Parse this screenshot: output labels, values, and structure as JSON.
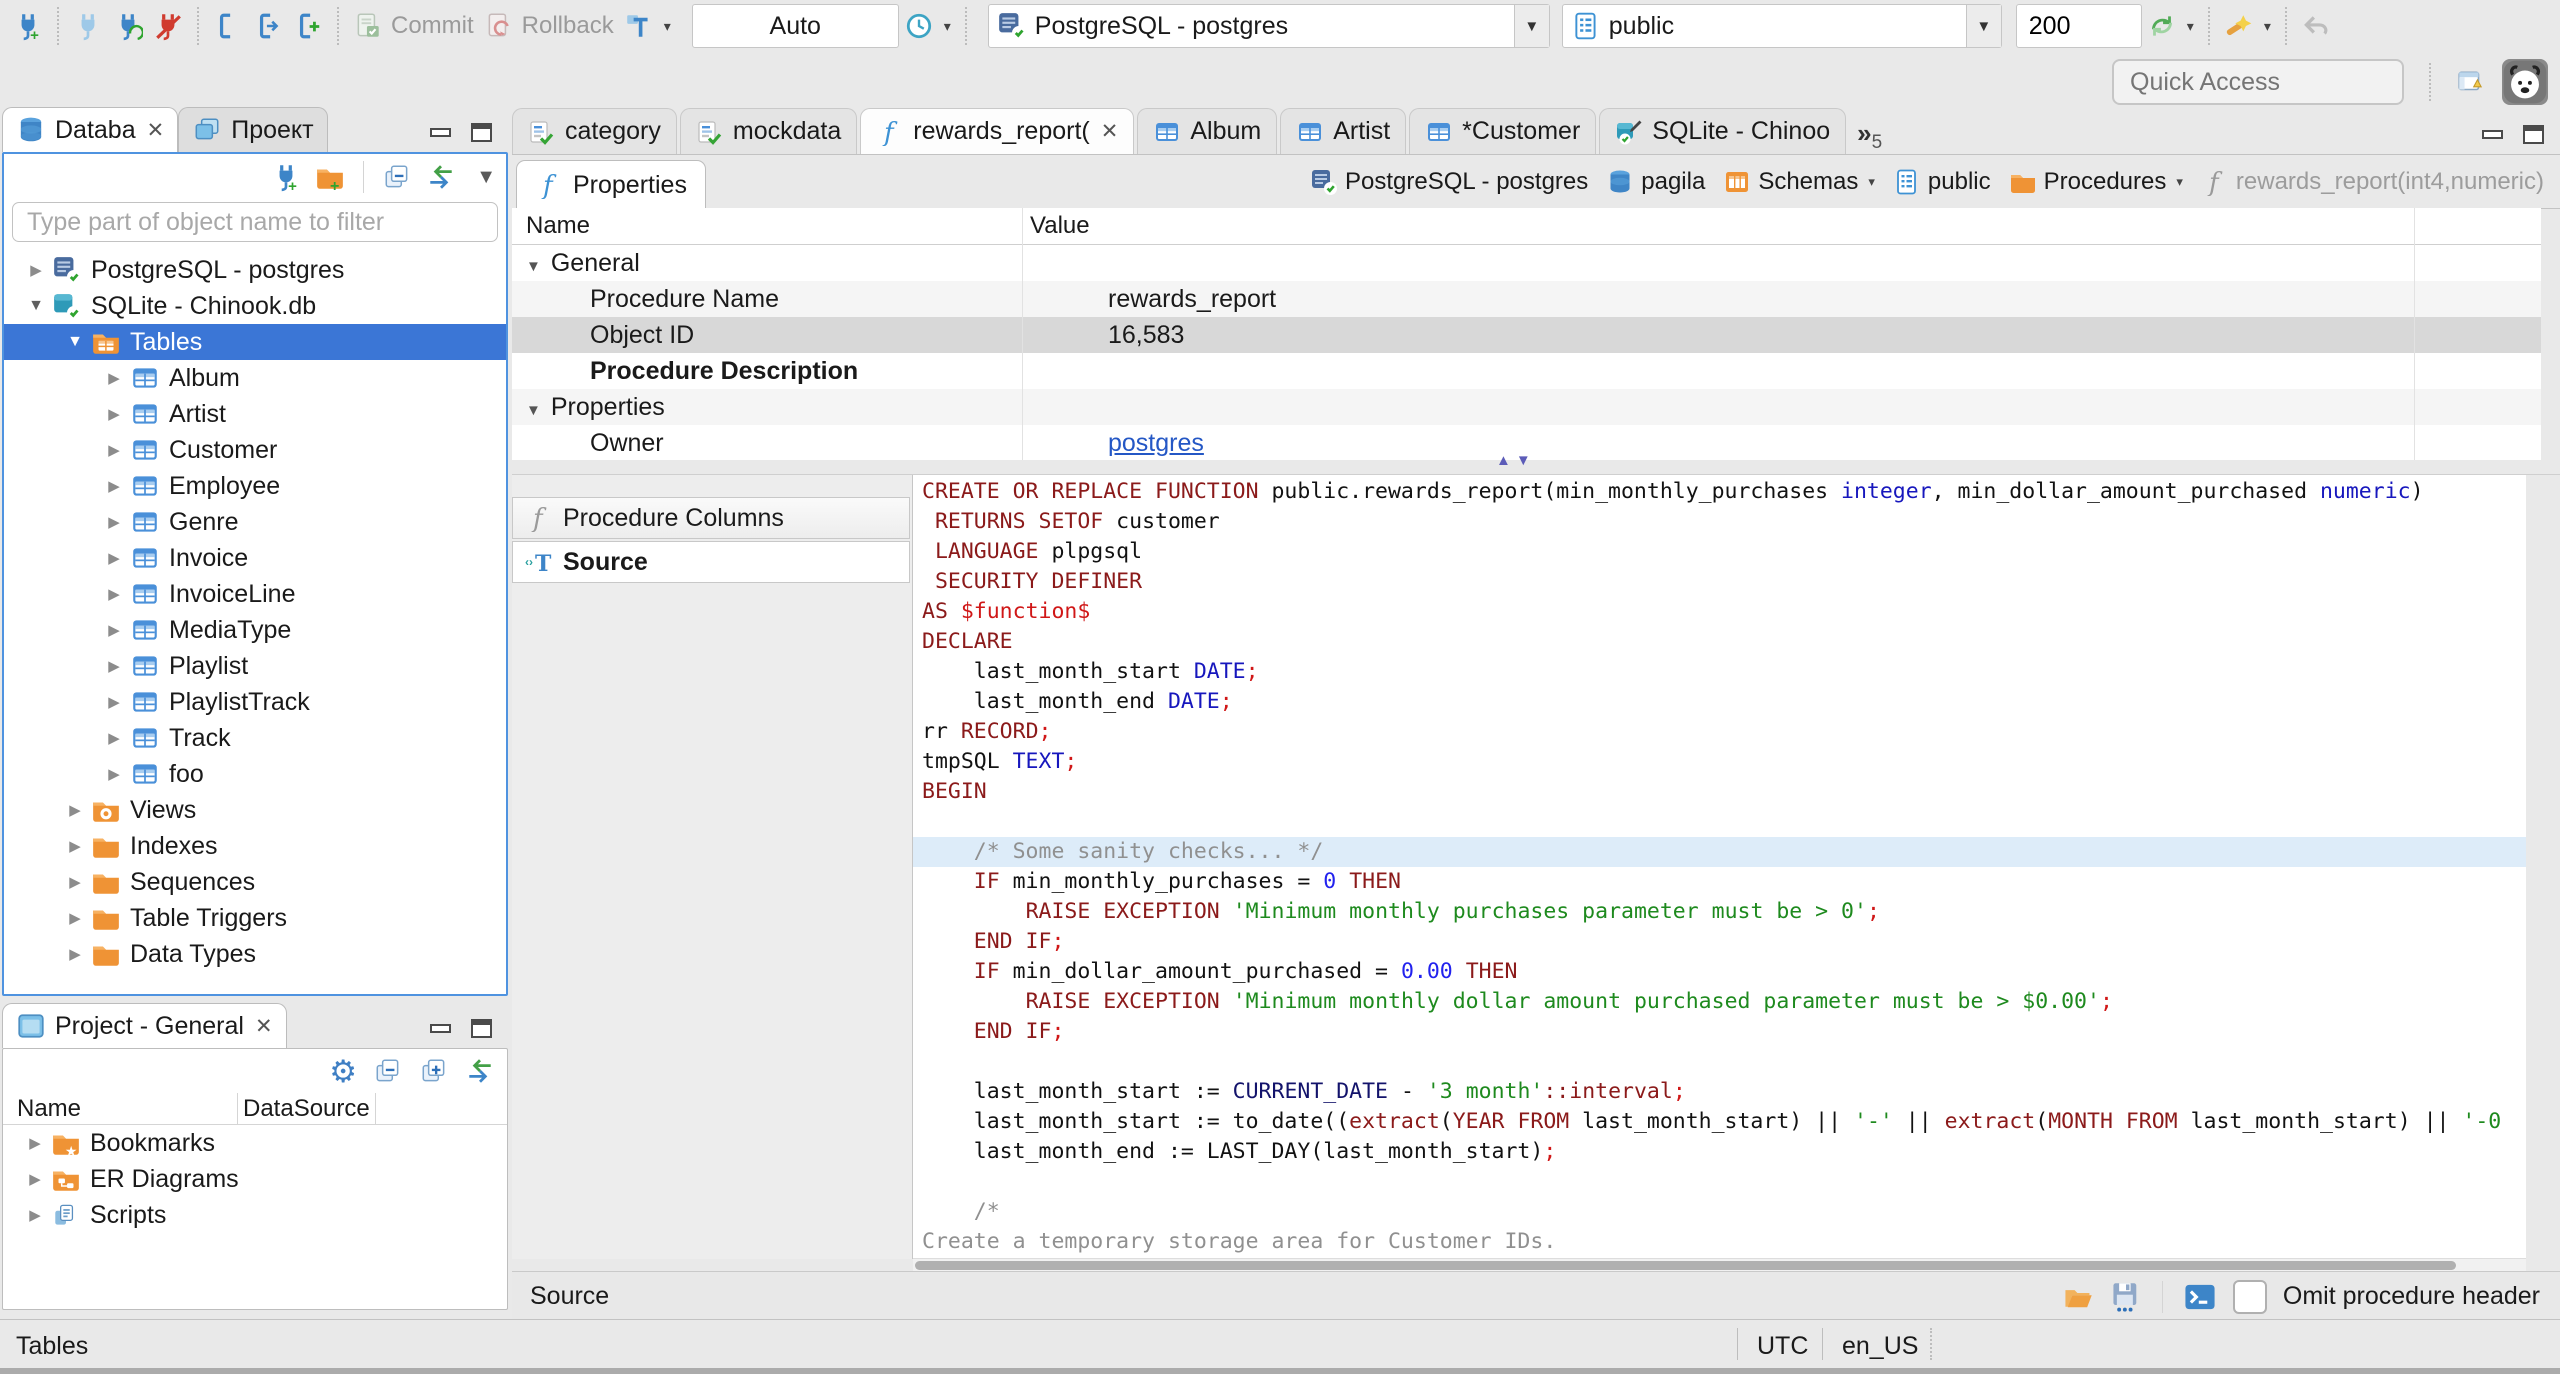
{
  "toolbar": {
    "commit": "Commit",
    "rollback": "Rollback",
    "auto": "Auto",
    "connection": "PostgreSQL - postgres",
    "schema": "public",
    "fetch_size": "200",
    "quick_access": "Quick Access"
  },
  "sidebar": {
    "tabs": [
      {
        "label": "Databa",
        "icon": "database-navigator",
        "active": true,
        "closable": true
      },
      {
        "label": "Проект",
        "icon": "projects",
        "active": false,
        "closable": false
      }
    ],
    "filter_placeholder": "Type part of object name to filter",
    "tree": [
      {
        "label": "PostgreSQL - postgres",
        "icon": "postgres-db",
        "level": 0,
        "state": "collapsed"
      },
      {
        "label": "SQLite - Chinook.db",
        "icon": "sqlite-db",
        "level": 0,
        "state": "expanded"
      },
      {
        "label": "Tables",
        "icon": "tables-folder",
        "level": 1,
        "state": "expanded",
        "selected": true
      },
      {
        "label": "Album",
        "icon": "table",
        "level": 2,
        "state": "collapsed"
      },
      {
        "label": "Artist",
        "icon": "table",
        "level": 2,
        "state": "collapsed"
      },
      {
        "label": "Customer",
        "icon": "table",
        "level": 2,
        "state": "collapsed"
      },
      {
        "label": "Employee",
        "icon": "table",
        "level": 2,
        "state": "collapsed"
      },
      {
        "label": "Genre",
        "icon": "table",
        "level": 2,
        "state": "collapsed"
      },
      {
        "label": "Invoice",
        "icon": "table",
        "level": 2,
        "state": "collapsed"
      },
      {
        "label": "InvoiceLine",
        "icon": "table",
        "level": 2,
        "state": "collapsed"
      },
      {
        "label": "MediaType",
        "icon": "table",
        "level": 2,
        "state": "collapsed"
      },
      {
        "label": "Playlist",
        "icon": "table",
        "level": 2,
        "state": "collapsed"
      },
      {
        "label": "PlaylistTrack",
        "icon": "table",
        "level": 2,
        "state": "collapsed"
      },
      {
        "label": "Track",
        "icon": "table",
        "level": 2,
        "state": "collapsed"
      },
      {
        "label": "foo",
        "icon": "table",
        "level": 2,
        "state": "collapsed"
      },
      {
        "label": "Views",
        "icon": "views-folder",
        "level": 1,
        "state": "collapsed"
      },
      {
        "label": "Indexes",
        "icon": "folder",
        "level": 1,
        "state": "collapsed"
      },
      {
        "label": "Sequences",
        "icon": "folder",
        "level": 1,
        "state": "collapsed"
      },
      {
        "label": "Table Triggers",
        "icon": "folder",
        "level": 1,
        "state": "collapsed"
      },
      {
        "label": "Data Types",
        "icon": "folder",
        "level": 1,
        "state": "collapsed"
      }
    ]
  },
  "project_panel": {
    "tab": "Project - General",
    "columns": [
      "Name",
      "DataSource"
    ],
    "items": [
      {
        "label": "Bookmarks",
        "icon": "bookmarks-folder"
      },
      {
        "label": "ER Diagrams",
        "icon": "er-folder"
      },
      {
        "label": "Scripts",
        "icon": "scripts"
      }
    ]
  },
  "editor": {
    "tabs": [
      {
        "label": "category",
        "icon": "sql-file"
      },
      {
        "label": "mockdata",
        "icon": "sql-file"
      },
      {
        "label": "rewards_report(",
        "icon": "function-blue",
        "active": true,
        "closable": true
      },
      {
        "label": "Album",
        "icon": "table"
      },
      {
        "label": "Artist",
        "icon": "table"
      },
      {
        "label": "*Customer",
        "icon": "table"
      },
      {
        "label": "SQLite - Chinoo",
        "icon": "sqlite-edit"
      }
    ],
    "overflow_count": "5",
    "properties_tab": "Properties",
    "breadcrumb": [
      {
        "label": "PostgreSQL - postgres",
        "icon": "postgres-db"
      },
      {
        "label": "pagila",
        "icon": "db-cylinder"
      },
      {
        "label": "Schemas",
        "icon": "schema-orange",
        "dropdown": true
      },
      {
        "label": "public",
        "icon": "schema-blue"
      },
      {
        "label": "Procedures",
        "icon": "folder",
        "dropdown": true
      },
      {
        "label": "rewards_report(int4,numeric)",
        "icon": "function-gray",
        "dim": true
      }
    ],
    "grid": {
      "columns": [
        "Name",
        "Value"
      ],
      "rows": [
        {
          "name": "General",
          "group": true
        },
        {
          "name": "Procedure Name",
          "value": "rewards_report",
          "shade": true
        },
        {
          "name": "Object ID",
          "value": "16,583",
          "selected": true
        },
        {
          "name": "Procedure Description",
          "value": "",
          "bold": true
        },
        {
          "name": "Properties",
          "group": true,
          "shade": true
        },
        {
          "name": "Owner",
          "value": "postgres",
          "link": true
        }
      ]
    },
    "subtabs": [
      {
        "label": "Procedure Columns",
        "icon": "function-gray"
      },
      {
        "label": "Source",
        "icon": "source-text",
        "active": true
      }
    ],
    "source_label": "Source",
    "omit_label": "Omit procedure header",
    "code": [
      {
        "seg": [
          [
            "k",
            "CREATE OR REPLACE FUNCTION"
          ],
          [
            "p",
            " public.rewards_report(min_monthly_purchases "
          ],
          [
            "t",
            "integer"
          ],
          [
            "p",
            ", min_dollar_amount_purchased "
          ],
          [
            "t",
            "numeric"
          ],
          [
            "p",
            ")"
          ]
        ]
      },
      {
        "seg": [
          [
            "p",
            " "
          ],
          [
            "k",
            "RETURNS SETOF"
          ],
          [
            "p",
            " customer"
          ]
        ]
      },
      {
        "seg": [
          [
            "p",
            " "
          ],
          [
            "k",
            "LANGUAGE"
          ],
          [
            "p",
            " plpgsql"
          ]
        ]
      },
      {
        "seg": [
          [
            "p",
            " "
          ],
          [
            "k",
            "SECURITY DEFINER"
          ]
        ]
      },
      {
        "seg": [
          [
            "k",
            "AS"
          ],
          [
            "p",
            " "
          ],
          [
            "r",
            "$function$"
          ]
        ]
      },
      {
        "seg": [
          [
            "k",
            "DECLARE"
          ]
        ]
      },
      {
        "seg": [
          [
            "p",
            "    last_month_start "
          ],
          [
            "t",
            "DATE"
          ],
          [
            "r",
            ";"
          ]
        ]
      },
      {
        "seg": [
          [
            "p",
            "    last_month_end "
          ],
          [
            "t",
            "DATE"
          ],
          [
            "r",
            ";"
          ]
        ]
      },
      {
        "seg": [
          [
            "p",
            "rr "
          ],
          [
            "k",
            "RECORD"
          ],
          [
            "r",
            ";"
          ]
        ]
      },
      {
        "seg": [
          [
            "p",
            "tmpSQL "
          ],
          [
            "t",
            "TEXT"
          ],
          [
            "r",
            ";"
          ]
        ]
      },
      {
        "seg": [
          [
            "k",
            "BEGIN"
          ]
        ]
      },
      {
        "seg": []
      },
      {
        "hl": true,
        "seg": [
          [
            "c",
            "    /* Some sanity checks... */"
          ]
        ]
      },
      {
        "seg": [
          [
            "p",
            "    "
          ],
          [
            "k",
            "IF"
          ],
          [
            "p",
            " min_monthly_purchases = "
          ],
          [
            "n",
            "0"
          ],
          [
            "p",
            " "
          ],
          [
            "k",
            "THEN"
          ]
        ]
      },
      {
        "seg": [
          [
            "p",
            "        "
          ],
          [
            "k",
            "RAISE EXCEPTION"
          ],
          [
            "p",
            " "
          ],
          [
            "s",
            "'Minimum monthly purchases parameter must be > 0'"
          ],
          [
            "r",
            ";"
          ]
        ]
      },
      {
        "seg": [
          [
            "p",
            "    "
          ],
          [
            "k",
            "END IF"
          ],
          [
            "r",
            ";"
          ]
        ]
      },
      {
        "seg": [
          [
            "p",
            "    "
          ],
          [
            "k",
            "IF"
          ],
          [
            "p",
            " min_dollar_amount_purchased = "
          ],
          [
            "n",
            "0.00"
          ],
          [
            "p",
            " "
          ],
          [
            "k",
            "THEN"
          ]
        ]
      },
      {
        "seg": [
          [
            "p",
            "        "
          ],
          [
            "k",
            "RAISE EXCEPTION"
          ],
          [
            "p",
            " "
          ],
          [
            "s",
            "'Minimum monthly dollar amount purchased parameter must be > $0.00'"
          ],
          [
            "r",
            ";"
          ]
        ]
      },
      {
        "seg": [
          [
            "p",
            "    "
          ],
          [
            "k",
            "END IF"
          ],
          [
            "r",
            ";"
          ]
        ]
      },
      {
        "seg": []
      },
      {
        "seg": [
          [
            "p",
            "    last_month_start := "
          ],
          [
            "d",
            "CURRENT_DATE"
          ],
          [
            "p",
            " - "
          ],
          [
            "s",
            "'3 month'"
          ],
          [
            "k",
            "::interval"
          ],
          [
            "r",
            ";"
          ]
        ]
      },
      {
        "seg": [
          [
            "p",
            "    last_month_start := to_date(("
          ],
          [
            "k",
            "extract"
          ],
          [
            "p",
            "("
          ],
          [
            "k",
            "YEAR FROM"
          ],
          [
            "p",
            " last_month_start) || "
          ],
          [
            "s",
            "'-'"
          ],
          [
            "p",
            " || "
          ],
          [
            "k",
            "extract"
          ],
          [
            "p",
            "("
          ],
          [
            "k",
            "MONTH FROM"
          ],
          [
            "p",
            " last_month_start) || "
          ],
          [
            "s",
            "'-0"
          ]
        ]
      },
      {
        "seg": [
          [
            "p",
            "    last_month_end := LAST_DAY(last_month_start)"
          ],
          [
            "r",
            ";"
          ]
        ]
      },
      {
        "seg": []
      },
      {
        "seg": [
          [
            "c",
            "    /*"
          ]
        ]
      },
      {
        "seg": [
          [
            "c",
            "Create a temporary storage area for Customer IDs."
          ]
        ]
      },
      {
        "seg": [
          [
            "c",
            "*/"
          ]
        ]
      }
    ]
  },
  "statusbar": {
    "left": "Tables",
    "timezone": "UTC",
    "locale": "en_US"
  },
  "colors": {
    "selection_blue": "#3b76d6",
    "focus_border": "#4f93e0",
    "link_blue": "#2457c5",
    "syntax_keyword": "#8b1a1a",
    "syntax_string": "#1e8a1e",
    "syntax_number": "#2222ee",
    "syntax_type": "#1717bd",
    "syntax_comment": "#909090",
    "syntax_punct": "#d01717",
    "current_line": "#ddecf9"
  }
}
